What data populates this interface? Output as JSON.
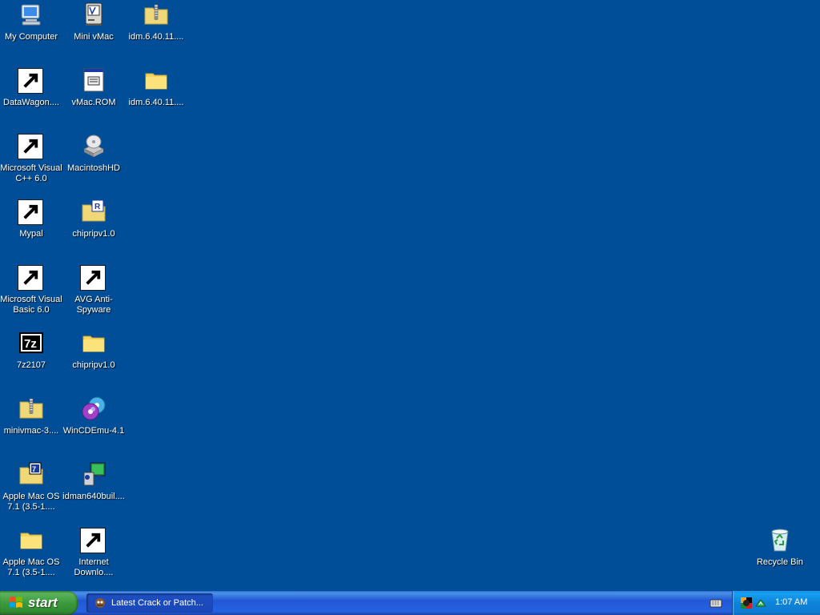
{
  "desktop": {
    "icons": [
      {
        "label": "My Computer",
        "icon": "my-computer-icon"
      },
      {
        "label": "DataWagon....",
        "icon": "datawagon-icon"
      },
      {
        "label": "Microsoft Visual C++ 6.0",
        "icon": "visual-cpp-icon"
      },
      {
        "label": "Mypal",
        "icon": "mypal-raccoon-icon"
      },
      {
        "label": "Microsoft Visual Basic 6.0",
        "icon": "visual-basic-icon"
      },
      {
        "label": "7z2107",
        "icon": "7zip-icon"
      },
      {
        "label": "minivmac-3....",
        "icon": "zip-folder-icon"
      },
      {
        "label": "Apple Mac OS 7.1 (3.5-1....",
        "icon": "7z-archive-folder-icon"
      },
      {
        "label": "Apple Mac OS 7.1 (3.5-1....",
        "icon": "folder-icon"
      },
      {
        "label": "Mini vMac",
        "icon": "mini-vmac-icon"
      },
      {
        "label": "vMac.ROM",
        "icon": "rom-file-icon"
      },
      {
        "label": "MacintoshHD",
        "icon": "disk-image-icon"
      },
      {
        "label": "chipripv1.0",
        "icon": "rar-folder-icon"
      },
      {
        "label": "AVG Anti-Spyware",
        "icon": "avg-anti-spyware-icon"
      },
      {
        "label": "chipripv1.0",
        "icon": "folder-icon"
      },
      {
        "label": "WinCDEmu-4.1",
        "icon": "wincdemu-icon"
      },
      {
        "label": "idman640buil....",
        "icon": "idm-installer-icon"
      },
      {
        "label": "Internet Downlo....",
        "icon": "internet-download-manager-icon"
      },
      {
        "label": "idm.6.40.11....",
        "icon": "zip-folder-icon"
      },
      {
        "label": "idm.6.40.11....",
        "icon": "folder-icon"
      },
      {
        "label": "Recycle Bin",
        "icon": "recycle-bin-icon"
      }
    ]
  },
  "taskbar": {
    "start_label": "start",
    "task_label": "Latest Crack or Patch...",
    "clock": "1:07 AM"
  },
  "colors": {
    "desktop_bg": "#004e98",
    "taskbar_blue": "#2663e0",
    "start_green": "#3c9a3c",
    "tray_blue": "#0d83d9"
  }
}
